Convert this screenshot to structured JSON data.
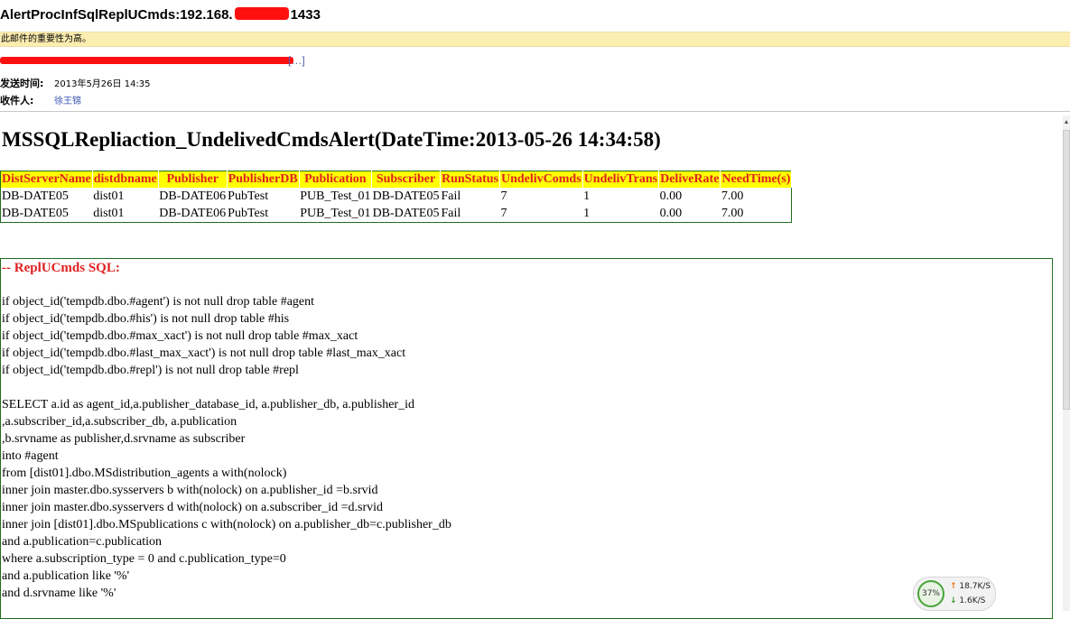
{
  "email": {
    "subject_prefix": "AlertProcInfSqlReplUCmds:192.168.",
    "subject_suffix": "1433",
    "importance_note": "此邮件的重要性为高。",
    "from_visible": "[…]",
    "sent_label": "发送时间:",
    "sent_value": "2013年5月26日  14:35",
    "to_label": "收件人:",
    "to_value": "徐王锦"
  },
  "body": {
    "heading": "MSSQLRepliaction_UndelivedCmdsAlert(DateTime:2013-05-26 14:34:58)",
    "table": {
      "columns": [
        "DistServerName",
        "distdbname",
        "Publisher",
        "PublisherDB",
        "Publication",
        "Subscriber",
        "RunStatus",
        "UndelivComds",
        "UndelivTrans",
        "DeliveRate",
        "NeedTime(s)"
      ],
      "rows": [
        [
          "DB-DATE05",
          "dist01",
          "DB-DATE06",
          "PubTest",
          "PUB_Test_01",
          "DB-DATE05",
          "Fail",
          "7",
          "1",
          "0.00",
          "7.00"
        ],
        [
          "DB-DATE05",
          "dist01",
          "DB-DATE06",
          "PubTest",
          "PUB_Test_01",
          "DB-DATE05",
          "Fail",
          "7",
          "1",
          "0.00",
          "7.00"
        ]
      ]
    },
    "sql_title": "-- ReplUCmds SQL:",
    "sql_lines": [
      "if object_id('tempdb.dbo.#agent') is not null drop table #agent",
      "if object_id('tempdb.dbo.#his') is not null drop table #his",
      "if object_id('tempdb.dbo.#max_xact') is not null drop table #max_xact",
      "if object_id('tempdb.dbo.#last_max_xact') is not null drop table #last_max_xact",
      "if object_id('tempdb.dbo.#repl') is not null drop table #repl",
      "SELECT a.id as agent_id,a.publisher_database_id, a.publisher_db, a.publisher_id",
      ",a.subscriber_id,a.subscriber_db, a.publication",
      ",b.srvname as publisher,d.srvname as subscriber",
      "into #agent",
      "from [dist01].dbo.MSdistribution_agents a with(nolock)",
      "inner join master.dbo.sysservers b with(nolock) on a.publisher_id =b.srvid",
      "inner join master.dbo.sysservers d with(nolock) on a.subscriber_id =d.srvid",
      "inner join [dist01].dbo.MSpublications c with(nolock) on a.publisher_db=c.publisher_db",
      "and a.publication=c.publication",
      "where a.subscription_type = 0 and c.publication_type=0",
      "and a.publication like '%'",
      "and d.srvname like '%'"
    ]
  },
  "network_widget": {
    "percent": "37%",
    "upload": "18.7K/S",
    "download": "1.6K/S"
  },
  "colors": {
    "header_bg": "#ffff00",
    "header_text": "#e02020",
    "border_green": "#1f6d1f",
    "importance_bar": "#fcedb0"
  }
}
